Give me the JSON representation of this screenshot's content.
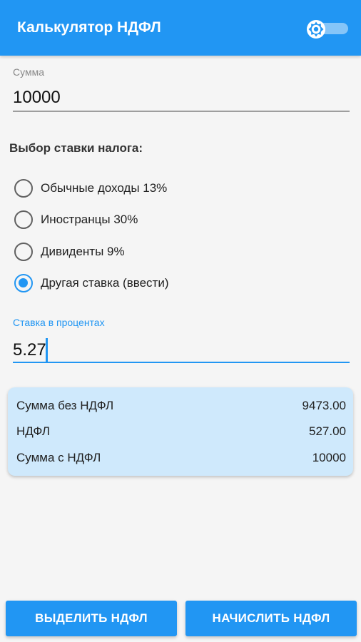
{
  "app_bar": {
    "title": "Калькулятор НДФЛ",
    "theme_toggle_icon": "brightness-icon",
    "theme_toggle_on": false
  },
  "amount": {
    "label": "Сумма",
    "value": "10000"
  },
  "tax_rate": {
    "title": "Выбор ставки налога:",
    "options": [
      {
        "label": "Обычные доходы 13%",
        "selected": false
      },
      {
        "label": "Иностранцы 30%",
        "selected": false
      },
      {
        "label": "Дивиденты 9%",
        "selected": false
      },
      {
        "label": "Другая ставка (ввести)",
        "selected": true
      }
    ]
  },
  "custom_rate": {
    "label": "Ставка в процентах",
    "value": "5.27"
  },
  "results": [
    {
      "label": "Сумма без НДФЛ",
      "value": "9473.00"
    },
    {
      "label": "НДФЛ",
      "value": "527.00"
    },
    {
      "label": "Сумма с НДФЛ",
      "value": "10000"
    }
  ],
  "buttons": {
    "extract": "ВЫДЕЛИТЬ НДФЛ",
    "add": "НАЧИСЛИТЬ НДФЛ"
  },
  "colors": {
    "primary": "#2196f3",
    "card_background": "#cfe9fc",
    "page_background": "#f5f5f5"
  }
}
